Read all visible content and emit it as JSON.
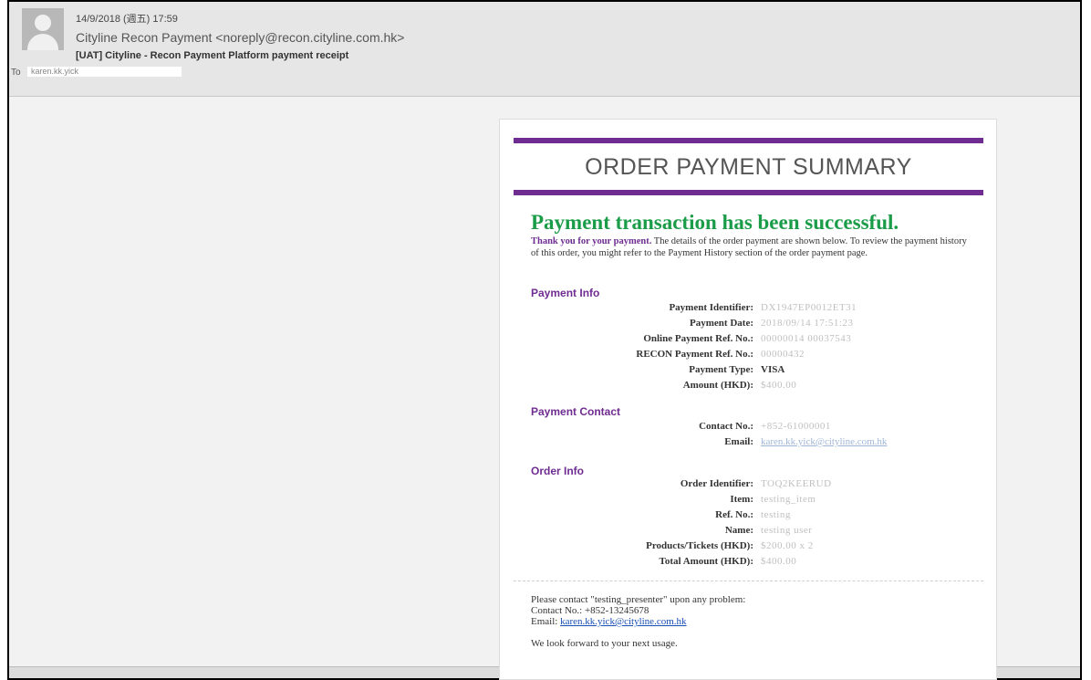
{
  "email": {
    "date": "14/9/2018 (週五) 17:59",
    "sender": "Cityline Recon Payment <noreply@recon.cityline.com.hk>",
    "subject": "[UAT] Cityline - Recon Payment Platform payment receipt",
    "to_label": "To",
    "to_value": "karen.kk.yick"
  },
  "receipt": {
    "title": "ORDER PAYMENT SUMMARY",
    "success_heading": "Payment transaction has been successful.",
    "thanks": "Thank you for your payment.",
    "intro_text": "The details of the order payment are shown below. To review the payment history of this order, you might refer to the Payment History section of the order payment page.",
    "payment_info": {
      "title": "Payment Info",
      "rows": [
        {
          "label": "Payment Identifier:",
          "value": "DX1947EP0012ET31"
        },
        {
          "label": "Payment Date:",
          "value": "2018/09/14 17:51:23"
        },
        {
          "label": "Online Payment Ref. No.:",
          "value": "00000014 00037543"
        },
        {
          "label": "RECON Payment Ref. No.:",
          "value": "00000432"
        },
        {
          "label": "Payment Type:",
          "value": "VISA"
        },
        {
          "label": "Amount (HKD):",
          "value": "$400.00"
        }
      ]
    },
    "payment_contact": {
      "title": "Payment Contact",
      "rows": [
        {
          "label": "Contact No.:",
          "value": "+852-61000001"
        },
        {
          "label": "Email:",
          "value": "karen.kk.yick@cityline.com.hk"
        }
      ]
    },
    "order_info": {
      "title": "Order Info",
      "rows": [
        {
          "label": "Order Identifier:",
          "value": "TOQ2KEERUD"
        },
        {
          "label": "Item:",
          "value": "testing_item"
        },
        {
          "label": "Ref. No.:",
          "value": "testing"
        },
        {
          "label": "Name:",
          "value": "testing user"
        },
        {
          "label": "Products/Tickets (HKD):",
          "value": "$200.00 x 2"
        },
        {
          "label": "Total Amount (HKD):",
          "value": "$400.00"
        }
      ]
    },
    "footer": {
      "contact_line": "Please contact \"testing_presenter\" upon any problem:",
      "contact_no": "Contact No.: +852-13245678",
      "email_label": "Email:",
      "email": "karen.kk.yick@cityline.com.hk",
      "closing": "We look forward to your next usage."
    }
  },
  "colors": {
    "accent_purple": "#6f2c91",
    "success_green": "#1a9c48",
    "link_blue": "#1a4fb5"
  }
}
